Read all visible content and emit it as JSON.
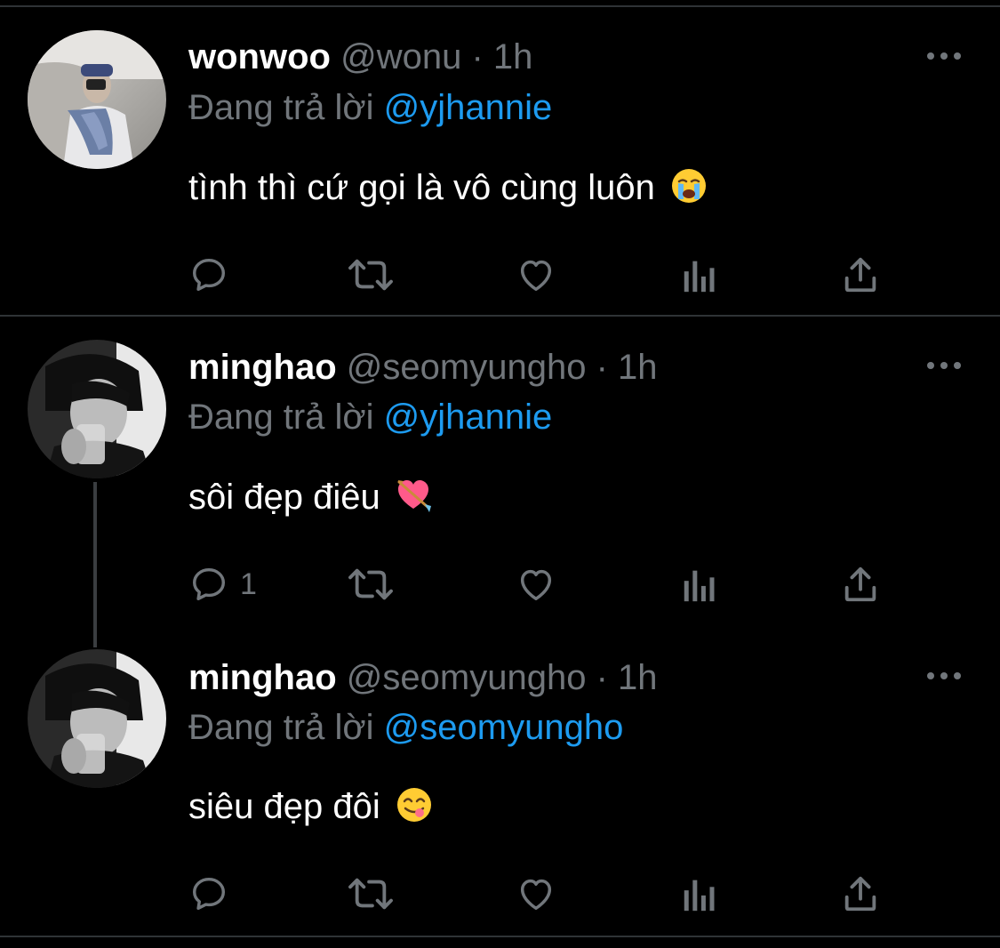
{
  "colors": {
    "background": "#000000",
    "divider": "#2f3336",
    "secondary_text": "#71767b",
    "mention": "#1d9bf0",
    "icon": "#71767b"
  },
  "tweets": [
    {
      "display_name": "wonwoo",
      "handle": "@wonu",
      "separator": "·",
      "time": "1h",
      "reply_prefix": "Đang trả lời",
      "reply_mention": "@yjhannie",
      "text": "tình thì cứ gọi là vô cùng luôn",
      "emoji": "loudly-crying-face-emoji",
      "reply_count": "",
      "avatar": "wonwoo-avatar-photo"
    },
    {
      "display_name": "minghao",
      "handle": "@seomyungho",
      "separator": "·",
      "time": "1h",
      "reply_prefix": "Đang trả lời",
      "reply_mention": "@yjhannie",
      "text": "sôi đẹp điêu",
      "emoji": "heart-with-arrow-emoji",
      "reply_count": "1",
      "avatar": "minghao-avatar-photo"
    },
    {
      "display_name": "minghao",
      "handle": "@seomyungho",
      "separator": "·",
      "time": "1h",
      "reply_prefix": "Đang trả lời",
      "reply_mention": "@seomyungho",
      "text": "siêu đẹp đôi",
      "emoji": "face-savoring-food-emoji",
      "reply_count": "",
      "avatar": "minghao-avatar-photo"
    }
  ],
  "icons": {
    "reply": "reply-icon",
    "retweet": "retweet-icon",
    "like": "heart-icon",
    "views": "views-icon",
    "share": "share-icon",
    "more": "more-icon"
  }
}
